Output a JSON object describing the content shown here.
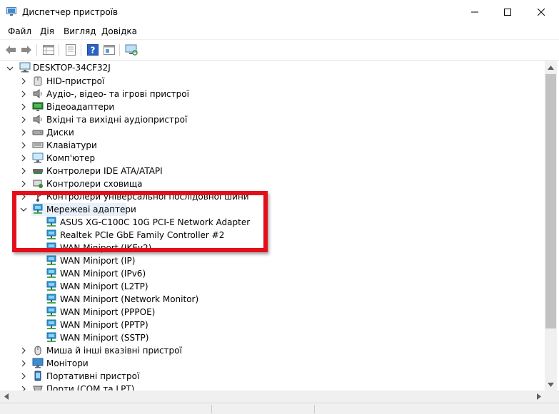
{
  "window": {
    "title": "Диспетчер пристроїв",
    "controls": [
      "minimize",
      "maximize",
      "close"
    ]
  },
  "menu": {
    "items": [
      "Файл",
      "Дія",
      "Вигляд",
      "Довідка"
    ]
  },
  "toolbar": {
    "buttons": [
      "back-icon",
      "forward-icon",
      "properties-grid-icon",
      "update-driver-icon",
      "help-icon",
      "view-icon",
      "monitor-scan-icon"
    ]
  },
  "tree": {
    "root": "DESKTOP-34CF32J",
    "categories": [
      {
        "label": "HID-пристрої",
        "icon": "hid-icon",
        "expanded": false
      },
      {
        "label": "Аудіо-, відео- та ігрові пристрої",
        "icon": "speaker-icon",
        "expanded": false
      },
      {
        "label": "Відеоадаптери",
        "icon": "display-adapter-icon",
        "expanded": false
      },
      {
        "label": "Вхідні та вихідні аудіопристрої",
        "icon": "speaker-icon",
        "expanded": false
      },
      {
        "label": "Диски",
        "icon": "disk-drive-icon",
        "expanded": false
      },
      {
        "label": "Клавіатури",
        "icon": "keyboard-icon",
        "expanded": false
      },
      {
        "label": "Комп'ютер",
        "icon": "computer-icon",
        "expanded": false
      },
      {
        "label": "Контролери IDE ATA/ATAPI",
        "icon": "ide-controller-icon",
        "expanded": false
      },
      {
        "label": "Контролери сховища",
        "icon": "storage-controller-icon",
        "expanded": false
      },
      {
        "label": "Контролери універсальної послідовної шини",
        "icon": "usb-icon",
        "expanded": false
      },
      {
        "label": "Мережеві адаптери",
        "icon": "network-adapter-icon",
        "expanded": true,
        "selected": true
      },
      {
        "label": "Миша й інші вказівні пристрої",
        "icon": "mouse-icon",
        "expanded": false
      },
      {
        "label": "Монітори",
        "icon": "monitor-icon",
        "expanded": false
      },
      {
        "label": "Портативні пристрої",
        "icon": "portable-device-icon",
        "expanded": false
      },
      {
        "label": "Порти (COM та LPT)",
        "icon": "port-icon",
        "expanded": false
      }
    ],
    "network_adapters": [
      "ASUS XG-C100C 10G PCI-E Network Adapter",
      "Realtek PCIe GbE Family Controller #2",
      "WAN Miniport (IKEv2)",
      "WAN Miniport (IP)",
      "WAN Miniport (IPv6)",
      "WAN Miniport (L2TP)",
      "WAN Miniport (Network Monitor)",
      "WAN Miniport (PPPOE)",
      "WAN Miniport (PPTP)",
      "WAN Miniport (SSTP)"
    ]
  },
  "colors": {
    "highlight_box": "#e3101c",
    "selection": "#e8f0fb",
    "network_icon": "#2f9bd6"
  }
}
